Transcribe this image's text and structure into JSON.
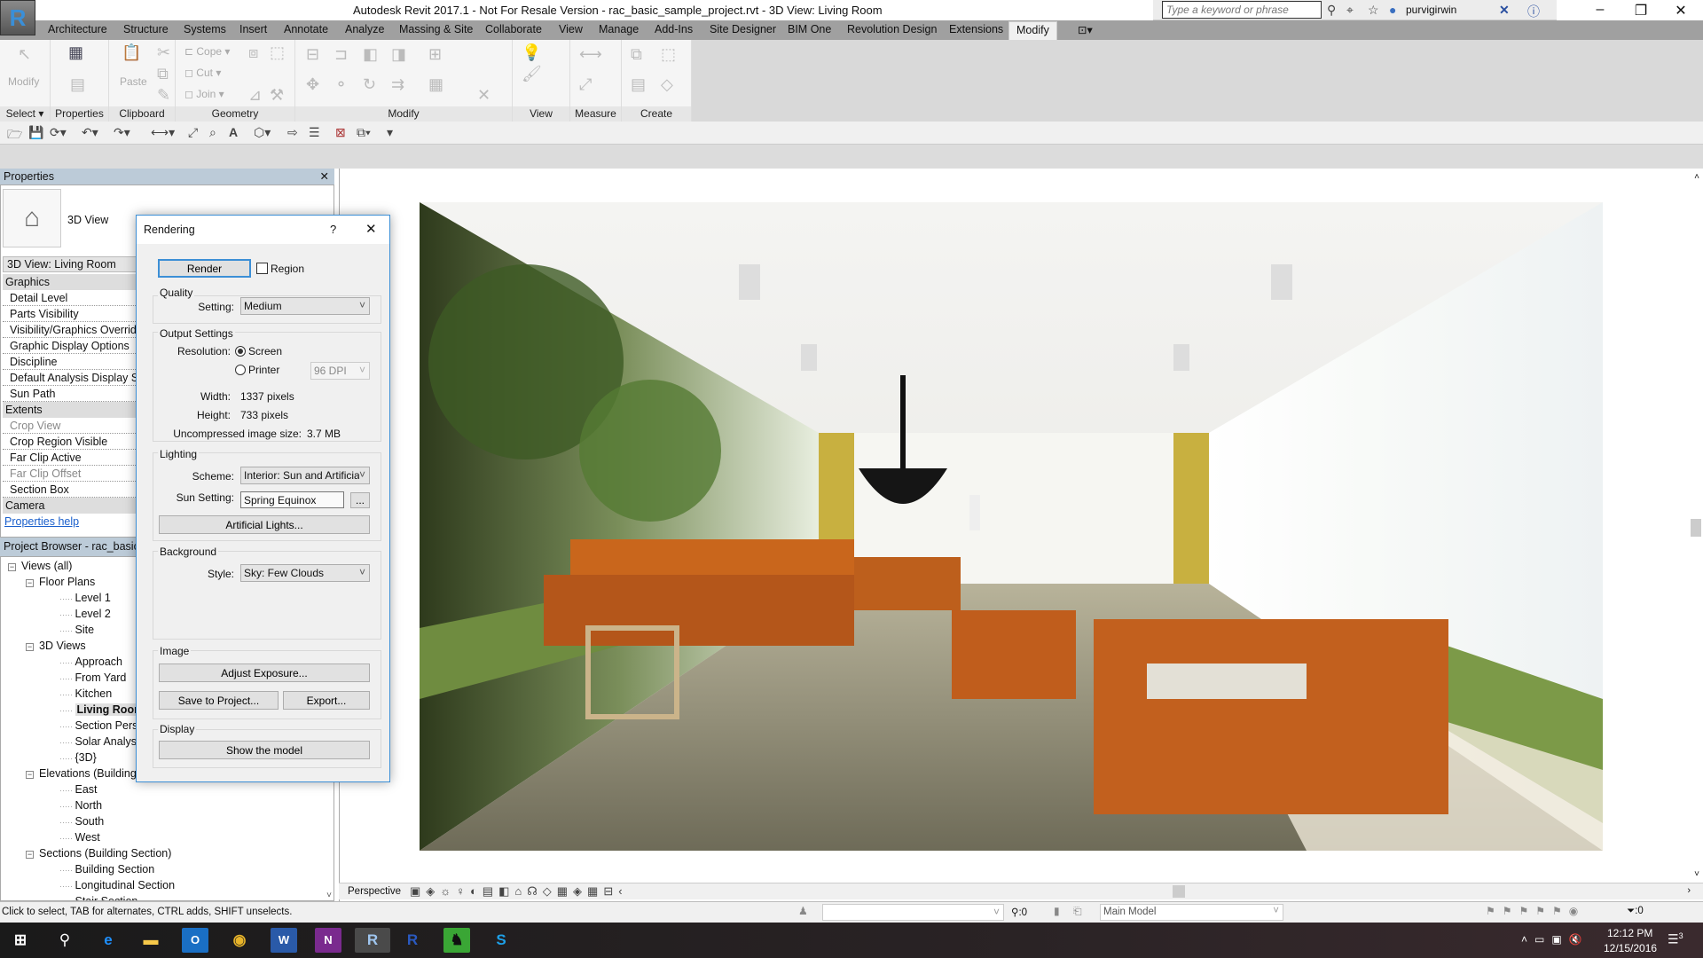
{
  "window": {
    "title": "Autodesk Revit 2017.1 - Not For Resale Version -    rac_basic_sample_project.rvt - 3D View: Living Room",
    "search_placeholder": "Type a keyword or phrase",
    "user": "purvigirwin",
    "app_letter": "R"
  },
  "menu_tabs": [
    "Architecture",
    "Structure",
    "Systems",
    "Insert",
    "Annotate",
    "Analyze",
    "Massing & Site",
    "Collaborate",
    "View",
    "Manage",
    "Add-Ins",
    "Site Designer",
    "BIM One",
    "Revolution Design",
    "Extensions",
    "Modify"
  ],
  "ribbon": {
    "panels": [
      "Select",
      "Properties",
      "Clipboard",
      "Geometry",
      "Modify",
      "View",
      "Measure",
      "Create"
    ],
    "modify_label": "Modify",
    "paste_label": "Paste",
    "cope_label": "Cope",
    "cut_label": "Cut",
    "join_label": "Join"
  },
  "properties": {
    "header": "Properties",
    "type_name": "3D View",
    "instance": "3D View: Living Room",
    "rows": [
      {
        "label": "Graphics",
        "group": true
      },
      {
        "label": "Detail Level"
      },
      {
        "label": "Parts Visibility"
      },
      {
        "label": "Visibility/Graphics Overrides"
      },
      {
        "label": "Graphic Display Options"
      },
      {
        "label": "Discipline"
      },
      {
        "label": "Default Analysis Display Style"
      },
      {
        "label": "Sun Path"
      },
      {
        "label": "Extents",
        "group": true
      },
      {
        "label": "Crop View",
        "dim": true
      },
      {
        "label": "Crop Region Visible"
      },
      {
        "label": "Far Clip Active"
      },
      {
        "label": "Far Clip Offset",
        "dim": true
      },
      {
        "label": "Section Box"
      },
      {
        "label": "Camera",
        "group": true
      }
    ],
    "help_link": "Properties help"
  },
  "project_browser": {
    "header": "Project Browser - rac_basic_sample_project.rvt",
    "items": [
      {
        "label": "Views (all)",
        "level": 0,
        "toggle": "−"
      },
      {
        "label": "Floor Plans",
        "level": 1,
        "toggle": "−"
      },
      {
        "label": "Level 1",
        "level": 2
      },
      {
        "label": "Level 2",
        "level": 2
      },
      {
        "label": "Site",
        "level": 2
      },
      {
        "label": "3D Views",
        "level": 1,
        "toggle": "−"
      },
      {
        "label": "Approach",
        "level": 2
      },
      {
        "label": "From Yard",
        "level": 2
      },
      {
        "label": "Kitchen",
        "level": 2
      },
      {
        "label": "Living Room",
        "level": 2,
        "selected": true
      },
      {
        "label": "Section Perspective",
        "level": 2
      },
      {
        "label": "Solar Analysis",
        "level": 2
      },
      {
        "label": "{3D}",
        "level": 2
      },
      {
        "label": "Elevations (Building Elevation)",
        "level": 1,
        "toggle": "−"
      },
      {
        "label": "East",
        "level": 2
      },
      {
        "label": "North",
        "level": 2
      },
      {
        "label": "South",
        "level": 2
      },
      {
        "label": "West",
        "level": 2
      },
      {
        "label": "Sections (Building Section)",
        "level": 1,
        "toggle": "−"
      },
      {
        "label": "Building Section",
        "level": 2
      },
      {
        "label": "Longitudinal Section",
        "level": 2
      },
      {
        "label": "Stair Section",
        "level": 2
      }
    ]
  },
  "rendering_dialog": {
    "title": "Rendering",
    "help": "?",
    "render_button": "Render",
    "region_label": "Region",
    "region_checked": false,
    "quality": {
      "group": "Quality",
      "setting_label": "Setting:",
      "setting_value": "Medium"
    },
    "output": {
      "group": "Output Settings",
      "resolution_label": "Resolution:",
      "screen_label": "Screen",
      "printer_label": "Printer",
      "selected": "Screen",
      "dpi_value": "96 DPI",
      "width_label": "Width:",
      "width_value": "1337 pixels",
      "height_label": "Height:",
      "height_value": "733 pixels",
      "size_label": "Uncompressed image size:",
      "size_value": "3.7 MB"
    },
    "lighting": {
      "group": "Lighting",
      "scheme_label": "Scheme:",
      "scheme_value": "Interior: Sun and Artificial",
      "sun_label": "Sun Setting:",
      "sun_value": "Spring Equinox",
      "more": "...",
      "artificial_button": "Artificial Lights..."
    },
    "background": {
      "group": "Background",
      "style_label": "Style:",
      "style_value": "Sky: Few Clouds"
    },
    "image": {
      "group": "Image",
      "adjust_button": "Adjust Exposure...",
      "save_button": "Save to Project...",
      "export_button": "Export..."
    },
    "display": {
      "group": "Display",
      "show_button": "Show the model"
    }
  },
  "view_bar": {
    "mode": "Perspective"
  },
  "status_bar": {
    "message": "Click to select, TAB for alternates, CTRL adds, SHIFT unselects.",
    "worksets_count": ":0",
    "model": "Main Model",
    "filter_count": ":0"
  },
  "taskbar": {
    "time": "12:12 PM",
    "date": "12/15/2016",
    "notifications": "3"
  },
  "colors": {
    "accent": "#3c8fd6",
    "properties_header": "#bccbd8",
    "menu_bar": "#a0a0a0"
  }
}
